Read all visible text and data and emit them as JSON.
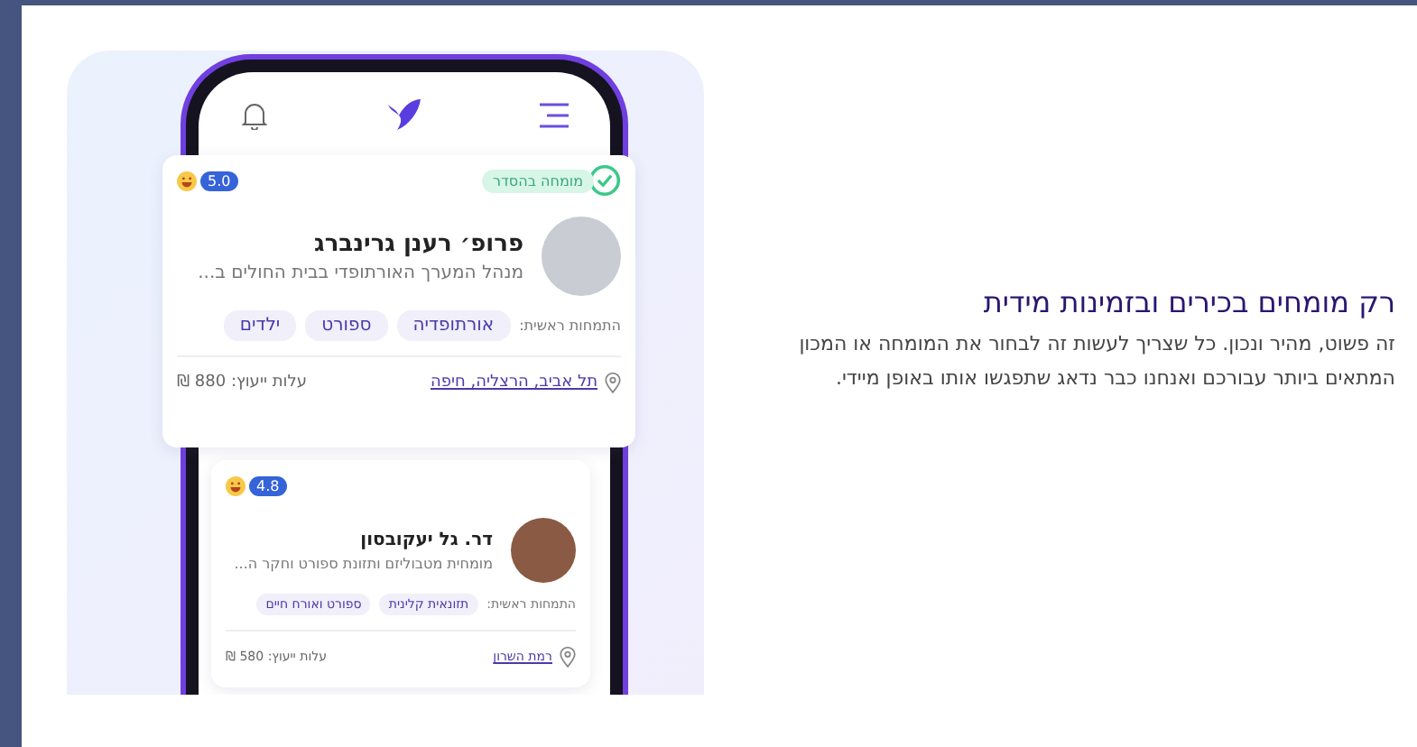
{
  "cards": [
    {
      "badge": "מומחה בהסדר",
      "rating": "5.0",
      "name": "פרופ׳ רענן גרינברג",
      "title": "מנהל המערך האורתופדי בבית החולים ב...",
      "specialties_label": "התמחות ראשית:",
      "tags": [
        "אורתופדיה",
        "ספורט",
        "ילדים"
      ],
      "locations": "תל אביב, הרצליה, חיפה",
      "price": "עלות ייעוץ: 880 ₪"
    },
    {
      "rating": "4.8",
      "name": "דר. גל יעקובסון",
      "title": "מומחית מטבוליזם ותזונת ספורט וחקר ה...",
      "specialties_label": "התמחות ראשית:",
      "tags": [
        "תזונאית קלינית",
        "ספורט ואורח חיים"
      ],
      "locations": "רמת השרון",
      "price": "עלות ייעוץ: 580 ₪"
    }
  ],
  "section": {
    "heading": "רק מומחים בכירים ובזמינות מידית",
    "body": "זה פשוט, מהיר ונכון. כל שצריך לעשות זה לבחור את המומחה או המכון המתאים ביותר עבורכם ואנחנו כבר נדאג שתפגשו אותו באופן מיידי."
  }
}
